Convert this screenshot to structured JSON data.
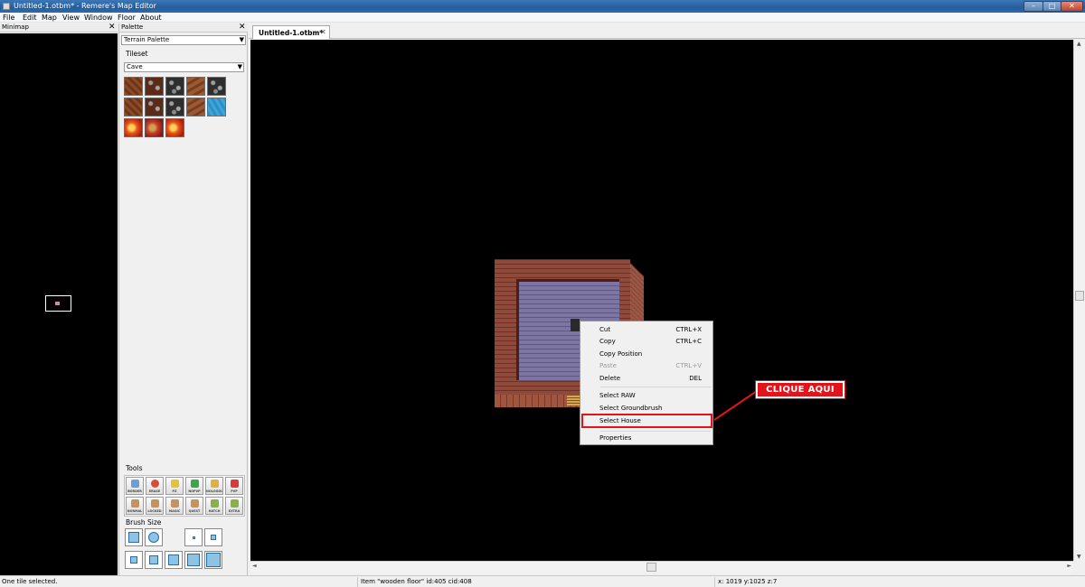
{
  "window": {
    "title": "Untitled-1.otbm* - Remere's Map Editor",
    "controls": {
      "minimize": "–",
      "maximize": "□",
      "close": "✕"
    }
  },
  "menu": [
    "File",
    "Edit",
    "Map",
    "View",
    "Window",
    "Floor",
    "About"
  ],
  "minimap": {
    "title": "Minimap",
    "close": "✕"
  },
  "palette": {
    "title": "Palette",
    "close": "✕",
    "type": "Terrain Palette",
    "tileset_label": "Tileset",
    "tileset": "Cave",
    "tiles": [
      "dirt",
      "rock",
      "rock",
      "dirt",
      "rock",
      "dirt",
      "rock",
      "rock",
      "dirt",
      "water",
      "lava",
      "lava",
      "lava"
    ],
    "tools_label": "Tools",
    "tools": [
      {
        "label": "BORDER",
        "color": "#6aa0d8"
      },
      {
        "label": "ERASE",
        "color": "#d84a3a"
      },
      {
        "label": "PZ",
        "color": "#e6c23a"
      },
      {
        "label": "NOPVP",
        "color": "#3aa84a"
      },
      {
        "label": "NOLOGOUT",
        "color": "#e0b040"
      },
      {
        "label": "PVP",
        "color": "#d83a3a"
      },
      {
        "label": "NORMAL",
        "color": "#c8935a"
      },
      {
        "label": "LOCKED",
        "color": "#c8935a"
      },
      {
        "label": "MAGIC",
        "color": "#c8935a"
      },
      {
        "label": "QUEST",
        "color": "#c8935a"
      },
      {
        "label": "HATCH",
        "color": "#8bb048"
      },
      {
        "label": "EXTRA",
        "color": "#8bb048"
      }
    ],
    "brush_label": "Brush Size"
  },
  "tab": {
    "label": "Untitled-1.otbm*",
    "close": "✕"
  },
  "context_menu": {
    "items": [
      {
        "label": "Cut",
        "shortcut": "CTRL+X",
        "enabled": true
      },
      {
        "label": "Copy",
        "shortcut": "CTRL+C",
        "enabled": true
      },
      {
        "label": "Copy Position",
        "shortcut": "",
        "enabled": true
      },
      {
        "label": "Paste",
        "shortcut": "CTRL+V",
        "enabled": false
      },
      {
        "label": "Delete",
        "shortcut": "DEL",
        "enabled": true
      },
      {
        "label": "Select RAW",
        "shortcut": "",
        "enabled": true
      },
      {
        "label": "Select Groundbrush",
        "shortcut": "",
        "enabled": true
      },
      {
        "label": "Select House",
        "shortcut": "",
        "enabled": true
      },
      {
        "label": "Properties",
        "shortcut": "",
        "enabled": true
      }
    ]
  },
  "annotation": {
    "text": "CLIQUE AQUI",
    "color": "#e1141c"
  },
  "status": {
    "left": "One tile selected.",
    "middle": "Item \"wooden floor\" id:405 cid:408",
    "right": "x: 1019 y:1025 z:7"
  }
}
